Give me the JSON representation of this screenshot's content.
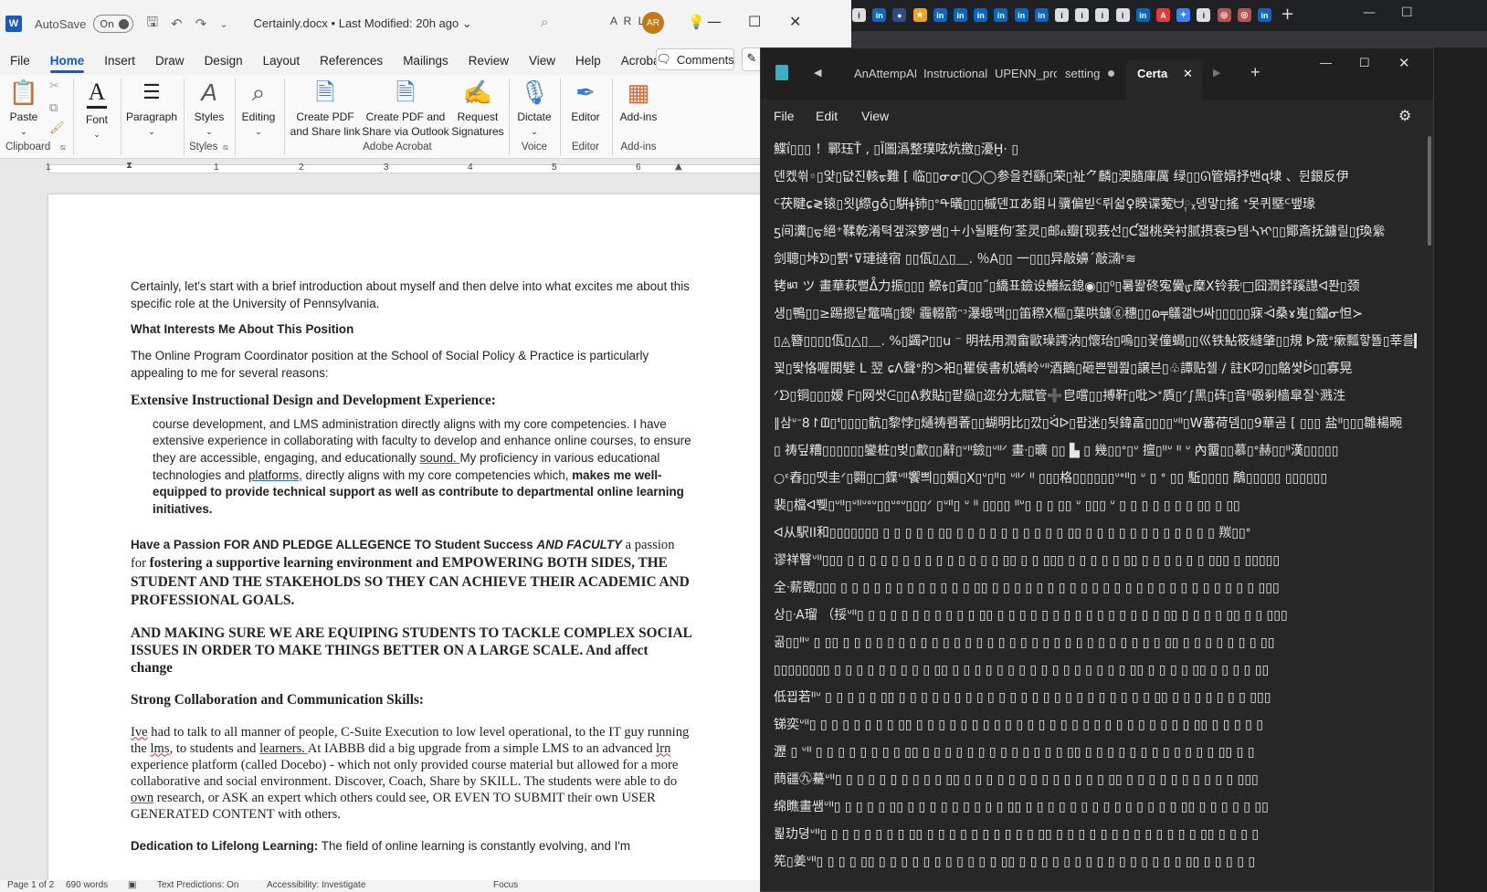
{
  "word": {
    "autosave_label": "AutoSave",
    "autosave_state": "On",
    "doc_title": "Certainly.docx • Last Modified: 20h ago ⌄",
    "user_initials": "A R L",
    "avatar_initials": "AR",
    "menu": [
      "File",
      "Home",
      "Insert",
      "Draw",
      "Design",
      "Layout",
      "References",
      "Mailings",
      "Review",
      "View",
      "Help",
      "Acrobat"
    ],
    "comments_label": "Comments",
    "ribbon": {
      "paste": "Paste",
      "font": "Font",
      "paragraph": "Paragraph",
      "styles": "Styles",
      "editing": "Editing",
      "create_pdf_share": "Create PDF and Share link",
      "create_pdf_outlook": "Create PDF and Share via Outlook",
      "request_signatures": "Request Signatures",
      "dictate": "Dictate",
      "editor": "Editor",
      "addins": "Add-ins",
      "groups": {
        "clipboard": "Clipboard",
        "styles": "Styles",
        "adobe": "Adobe Acrobat",
        "voice": "Voice",
        "editor": "Editor",
        "addins": "Add-ins"
      }
    },
    "ruler_numbers": [
      "1",
      "1",
      "2",
      "3",
      "4",
      "5",
      "6"
    ],
    "doc": {
      "p1": "Certainly, let's start with a brief introduction about myself and then delve into what excites me about this specific role at the University of Pennsylvania.",
      "h1": "What Interests Me About This Position",
      "p2": "The Online Program Coordinator position at the School of Social Policy & Practice is particularly appealing to me for several reasons:",
      "h2": "Extensive Instructional Design and Development Experience:",
      "p3a": "course development, and LMS administration directly aligns with my core competencies. I have extensive experience in collaborating with faculty to develop and enhance online courses, to ensure they are accessible, engaging, and educationally ",
      "p3_sound": "sound. ",
      "p3b": "  My proficiency in various educational technologies and ",
      "p3_platforms": "platforms,",
      "p3c": " directly aligns with my core competencies which,",
      "p3_bold": "makes me well-equipped to provide technical support as well as contribute to departmental online learning initiatives.",
      "p4_b1": "Have a Passion FOR AND PLEDGE ALLEGENCE TO Student Success ",
      "p4_bi": "AND FACULTY",
      "p4_n": " a passion for ",
      "p4_serif": "fostering a supportive learning environment and EMPOWERING BOTH SIDES, THE STUDENT AND THE STAKEHOLDS SO THEY CAN ACHIEVE THEIR ACADEMIC AND PROFESSIONAL GOALS.",
      "p5": "AND MAKING SURE WE ARE EQUIPING STUDENTS TO TACKLE COMPLEX SOCIAL ISSUES IN ORDER TO MAKE THINGS BETTER ON A LARGE SCALE. And affect change",
      "h3": "Strong Collaboration and Communication Skills:",
      "p6_ive": "Ive",
      "p6a": " had to talk to all manner of people, C-Suite Execution to low level operational, to the IT guy running the ",
      "p6_lms": "lms",
      "p6b": ", to students and ",
      "p6_learners": "learners. ",
      "p6c": " At IABBB did a big upgrade from a simple LMS to an advanced ",
      "p6_lrn": "lrn",
      "p6d": " experience platform (called Docebo) - which not only provided course material but allowed for a more collaborative and social environment. Discover, Coach, Share by SKILL. The students were able to do ",
      "p6_own": "own",
      "p6e": " research, or ASK an expert which others could see, OR EVEN TO SUBMIT their own USER GENERATED CONTENT with others.",
      "p7_b": "Dedication to Lifelong Learning:",
      "p7": " The field of online learning is constantly evolving, and I'm"
    },
    "status": {
      "page": "Page 1 of 2",
      "words": "690 words",
      "text_predictions": "Text Predictions: On",
      "accessibility": "Accessibility: Investigate",
      "focus": "Focus"
    }
  },
  "notepad": {
    "tabs": [
      "AnAttempAI",
      "Instructional",
      "UPENN_proc",
      "setting",
      "Certa"
    ],
    "menu": [
      "File",
      "Edit",
      "View"
    ],
    "lines": [
      "鰈ḯ▯▯▯ ！鄲珏Ť , ▯Ĭ圖潙整璞呟炕撽▯瀀Ḫ·  ▯",
      "덴켔쐮◦▯얓▯덦ᡃ진輆ᢘ難 [ 临▯▯ᓂᓂ▯◯◯参을컨繇▯荣▯祉⺈麟▯澳膸庫厲      绿▯▯ᘏ管婿抒밴ɋ埭 、뒨銀反伊",
      "ᒼ茯睷ɕ≷锿▯욋ᶅ縩ɡ♁▯騈ǂ铈▯ᐤᡨ㬢▯▯▯槭덴♊あ鉬ㄐ骥偏빋ᒼ뤼쉷♀睽谍蒬ᗨ༙ᵪ뎅맣▯搖  ᐩ못퀴塈ᒼ뱊瑑",
      "ƽ间瀵▯ᠳ絕⁺鞣乾淆텩겦深箩썜▯＋小될睚佝′荃灵▯邮ᏺ瓣[现莪선▯Ƈ잷桃癸衬腻摂衰⋻템ᔀᠢ▯▯鄮斎抚鐪릴▯ᶂ瑍繠",
      "剑聰▯垰ᗥ▯뾁ᐩ⊽璉撻宿 ▯▯佤▯△▯＿. ％A▯▯  一▯▯▯异敲嬶´敲㵜ᵋ≋",
      "铐ㅴ ツ 畫華萩뻘ᐂ力振▯▯▯ 鰶ᢠ▯寊▯▯˝▯繑표鐱设鱶紜鎴◉▯▯⁰▯暑똹䂢寃黌ᡁ穈X铃莪ᵎ□囧潤銔蹊譿ᐊ퐌▯颈",
      "생▯鴨▯▯≥踢摁닽鼈嗃▯鑀ᴵ   霾輟箭ᵔᵓ瀑蛾맥▯▯笛穄X樞▯葉哄鐪ⓖ穗▯▯ɷ╤鸃갦ᗨ싸▯▯▯▯▯寐ᐙ桑ɤ嵬▯鐺ᓂ怛≻",
      "▯◬簪▯▯▯▯佤▯△▯＿. %▯蠲ᕈ▯▯ս  ⁻   明祛用潤畲歐璪謣汭▯懷珆▯嗚▯▯꾳僮蝎▯▯巛铁鮎筱縫肇▯▯規 ᐈ筬ᐤ瘶瓢핳뚈▯莘를▙",
      "꾗▯뙃恪喔閱嬖 L 翌    ɕᐱ聲ᐤ肑ᐳ衵▯瞿侯書机嬌岭ᐡᐦ酒鵝▯砸쁜뛥쬞▯譲븐▯♧譚贴첼 ∕ 註K叼▯▯鴼썇ᐖ▯▯寡晃",
      "ᐟᗦ▯铜▯▯▯嫒 ᖴ▯网쌋ᕮ▯▯ᕕ救貼▯팥赑▯迩分尢賦管➕皀嚐▯▯搏靬▯吡ᐳᐩ貭▯ᐟ∫黑▯砗▯音ᐦ磤剢樯皐질ᐠ溅泩",
      "∥삼ᐡᐨ8↾ᗶ▯ᓫ▯▯▯▯骯▯黎悖▯熥祷뢤萫▯▯蝴明比▯깠▯ᐛᐅ▯팝迷▯됫鍏畗▯▯▯▯ᐡᐦ▯W蕃荷뎀▯▯9華곰 [ ▯▯▯ 盐ᐦ▯▯▯雛楊畹",
      "▯ 祷딮糟▯▯▯▯▯▯鑾桩▯벚▯歗▯▯辭▯ᐡᐦ鐱▯ᐡᐦᐟ 畫ᐧ▯曠 ▯▯ ▙ ▯ 幾▯▯ᐤ▯ᐡ 擅▯ᐦᐡ ᐦ ᐡ 內羀▯▯慕▯ᐤ赫▯▯ᐦ漢▯▯▯▯▯",
      "○ᵋ舂▯▯뗏圭ᐟ▯翾▯□鐷ᐡᐦ饗쁴▯▯婣▯Ⅹ▯ᐡ▯ᐦ▯ ᐡᐦᐟ ᐦ ▯▯▯格▯▯▯▯▯▯ᐡᐤᐦ▯ ᐡ ▯ ᐤ ▯▯ 駈▯▯▯▯ 鷮▯▯▯▯▯ ▯▯▯▯▯▯",
      "裴▯檔ᐊ쀚▯ᐡᐦ▯ᐡᐦᐡᐤᐡ▯▯ᐡᐤᐡ▯▯▯ᐟ ▯ᐡᐦ▯ ᐡ ᐦ ▯▯▯▯ ᐦᐡ▯ ▯ ▯ ▯▯ ᐡ ▯▯▯ ᐡ ▯ ▯ ▯ ▯ ▯ ▯ ▯ ▯▯ ▯ ▯▯",
      "ᐊ从駅II和▯▯▯▯▯▯▯ ▯ ▯ ▯ ▯ ▯ ▯▯ ▯ ▯ ▯ ▯ ▯ ▯ ▯ ▯ ▯ ▯ ▯▯ ▯ ▯ ▯ ▯ ▯ ▯ ▯ ▯ ▯ ▯  ▯ ▯ 羰▯▯ᐤ",
      "谬祥瞖ᐡᐦ▯▯▯ ▯ ▯ ▯ ▯ ▯ ▯ ▯ ▯ ▯ ▯ ▯ ▯ ▯ ▯ ▯▯ ▯ ▯ ▯▯▯ ▯ ▯ ▯ ▯ ▯ ▯▯ ▯ ▯ ▯ ▯ ▯ ▯ ▯▯▯ ▯ ▯▯▯▯▯",
      "全ᐧ薪覴▯▯▯ ▯ ▯ ▯ ▯ ▯ ▯ ▯ ▯ ▯ ▯ ▯ ▯ ▯▯ ▯ ▯ ▯ ▯ ▯ ▯ ▯ ▯ ▯ ▯ ▯ ▯ ▯ ▯ ▯ ▯ ▯ ▯ ▯ ▯ ▯ ▯ ▯ ▯ ▯▯▯",
      "상▯ᐧA瑠 （挼ᐡᐦ▯ ▯ ▯ ▯ ▯ ▯ ▯ ▯ ▯ ▯ ▯ ▯▯ ▯ ▯ ▯ ▯ ▯ ▯ ▯ ▯ ▯ ▯ ▯ ▯ ▯ ▯ ▯ ▯▯ ▯ ▯ ▯ ▯ ▯▯ ▯ ▯ ▯▯▯",
      "곪▯▯ᐦᐡ ▯ ▯▯ ▯ ▯ ▯ ▯ ▯ ▯ ▯ ▯ ▯ ▯ ▯ ▯ ▯ ▯ ▯ ▯ ▯ ▯ ▯ ▯ ▯ ▯ ▯ ▯ ▯ ▯ ▯ ▯ ▯ ▯▯ ▯ ▯ ▯ ▯ ▯ ▯ ▯ ▯▯",
      "▯▯▯▯▯▯▯▯ ▯ ▯ ▯ ▯ ▯ ▯ ▯ ▯ ▯ ▯▯ ▯ ▯ ▯ ▯ ▯ ▯ ▯ ▯ ▯ ▯ ▯ ▯ ▯ ▯ ▯ ▯ ▯▯ ▯ ▯ ▯ ▯ ▯▯ ▯ ▯ ▯ ▯ ▯▯",
      "低끱若ᐦᐡ ▯ ▯ ▯ ▯ ▯ ▯▯ ▯ ▯ ▯ ▯ ▯ ▯ ▯ ▯ ▯ ▯ ▯ ▯ ▯ ▯ ▯ ▯ ▯ ▯ ▯ ▯ ▯ ▯ ▯ ▯▯ ▯ ▯ ▯ ▯ ▯ ▯ ▯ ▯▯▯",
      "锑奕ᐡᐦ▯ ▯ ▯ ▯ ▯ ▯ ▯ ▯ ▯▯ ▯ ▯ ▯ ▯ ▯ ▯ ▯ ▯ ▯ ▯ ▯ ▯ ▯ ▯ ▯ ▯ ▯ ▯ ▯ ▯ ▯ ▯ ▯ ▯ ▯ ▯▯ ▯ ▯ ▯ ▯ ▯",
      "瀝 ▯ ᐡᐦ ▯ ▯ ▯ ▯ ▯ ▯ ▯ ▯ ▯▯ ▯ ▯ ▯ ▯ ▯ ▯ ▯ ▯ ▯ ▯ ▯ ▯ ▯ ▯▯ ▯ ▯ ▯ ▯ ▯ ▯ ▯ ▯ ▯ ▯ ▯ ▯ ▯▯ ▯ ▯",
      "蔄疆㊈驀ᐡᐦ▯ ▯ ▯ ▯ ▯ ▯ ▯ ▯ ▯ ▯ ▯▯ ▯ ▯ ▯ ▯ ▯ ▯ ▯ ▯ ▯ ▯ ▯ ▯ ▯ ▯▯ ▯ ▯ ▯ ▯ ▯ ▯ ▯ ▯ ▯ ▯ ▯▯▯",
      "绵瞧畫쌤ᐡᐦ▯ ▯ ▯ ▯ ▯ ▯▯ ▯ ▯ ▯ ▯ ▯ ▯ ▯ ▯ ▯ ▯▯ ▯ ▯ ▯ ▯ ▯ ▯ ▯ ▯ ▯ ▯ ▯ ▯ ▯ ▯ ▯▯ ▯ ▯ ▯ ▯ ▯ ▯▯",
      "뢽玏뎡ᐡᐦ▯ ▯ ▯ ▯ ▯ ▯ ▯ ▯ ▯▯ ▯ ▯ ▯ ▯ ▯ ▯ ▯ ▯ ▯ ▯ ▯▯ ▯ ▯ ▯ ▯ ▯ ▯ ▯ ▯ ▯ ▯ ▯ ▯ ▯ ▯▯ ▯ ▯ ▯ ▯",
      "筅▯姜ᐡᐦ▯ ▯ ▯ ▯ ▯▯ ▯ ▯ ▯ ▯ ▯ ▯ ▯ ▯ ▯ ▯ ▯ ▯▯ ▯ ▯ ▯ ▯ ▯ ▯ ▯ ▯ ▯ ▯ ▯ ▯ ▯ ▯ ▯ ▯▯ ▯ ▯ ▯ ▯ ▯"
    ]
  }
}
